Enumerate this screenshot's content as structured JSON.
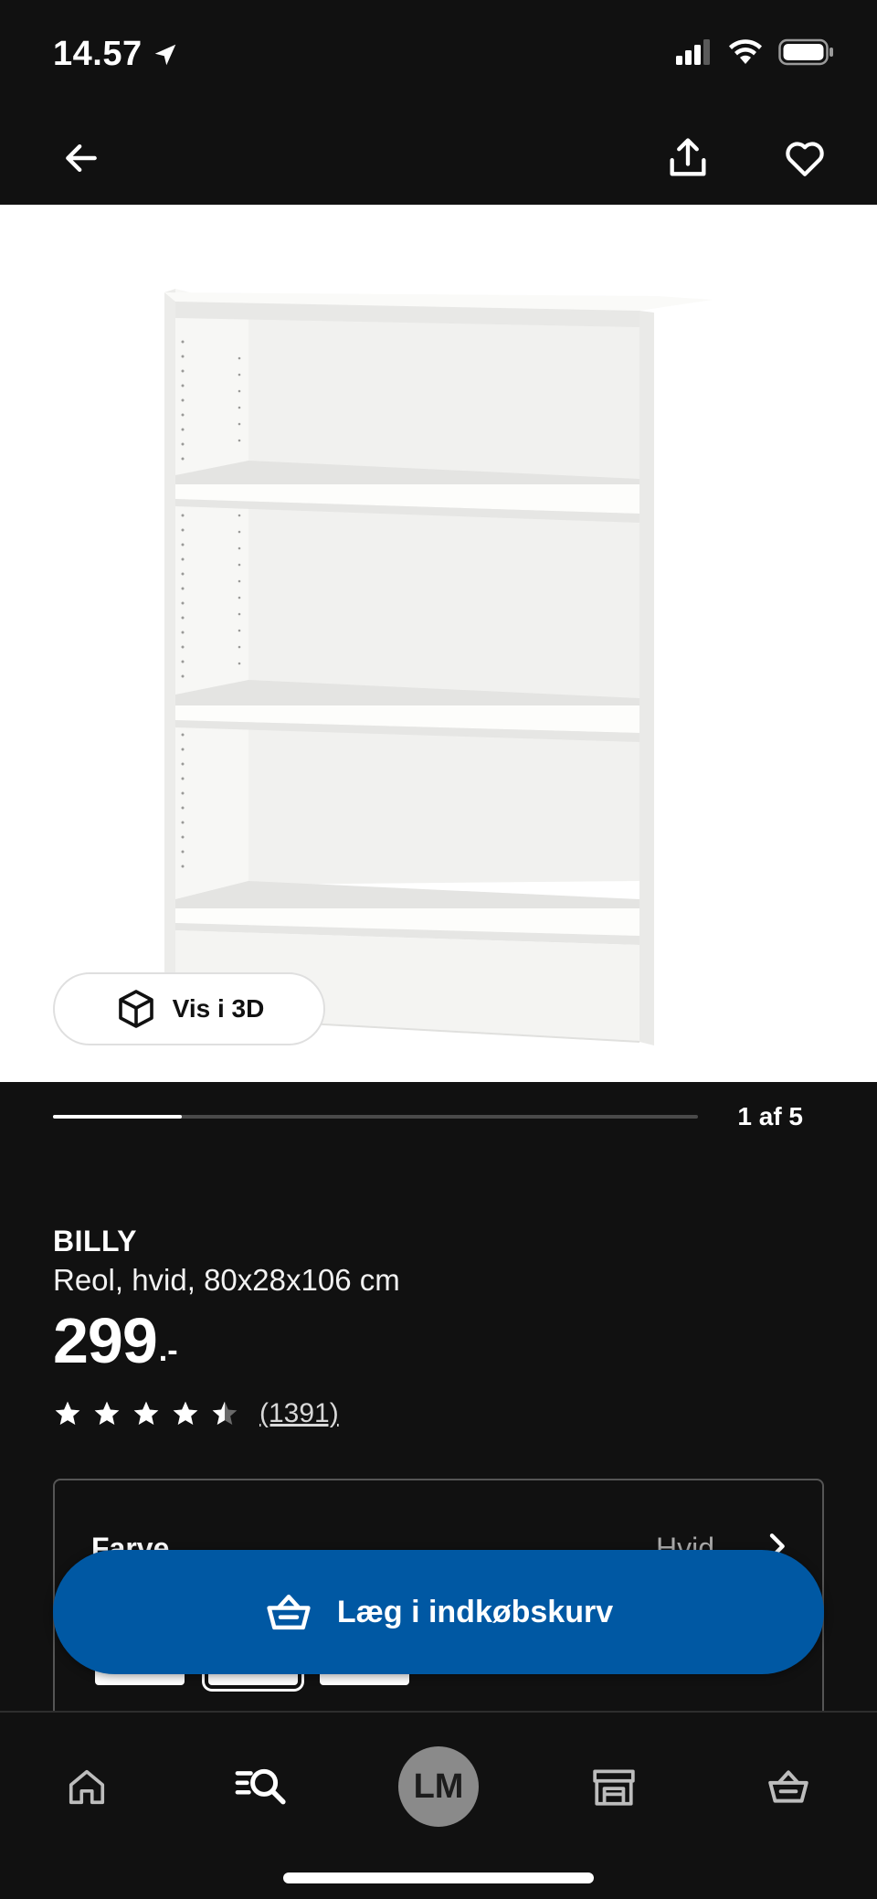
{
  "status_bar": {
    "time": "14.57"
  },
  "product": {
    "name": "BILLY",
    "description": "Reol, hvid, 80x28x106 cm",
    "price": "299",
    "price_suffix": ".-",
    "rating": 4.5,
    "review_count": "(1391)"
  },
  "gallery": {
    "view_3d_label": "Vis i 3D",
    "position": "1 af 5",
    "progress_fraction": 0.2
  },
  "options": {
    "label": "Farve",
    "value": "Hvid"
  },
  "cart_button": {
    "label": "Læg i indkøbskurv"
  },
  "bottom_nav": {
    "avatar_initials": "LM"
  },
  "colors": {
    "accent": "#0058a3",
    "background": "#111111",
    "surface": "#ffffff"
  },
  "icons": [
    "location-arrow-icon",
    "signal-icon",
    "wifi-icon",
    "battery-icon",
    "back-arrow-icon",
    "share-icon",
    "heart-icon",
    "cube-icon",
    "star-icon",
    "chevron-right-icon",
    "basket-icon",
    "home-icon",
    "search-list-icon",
    "store-icon"
  ]
}
